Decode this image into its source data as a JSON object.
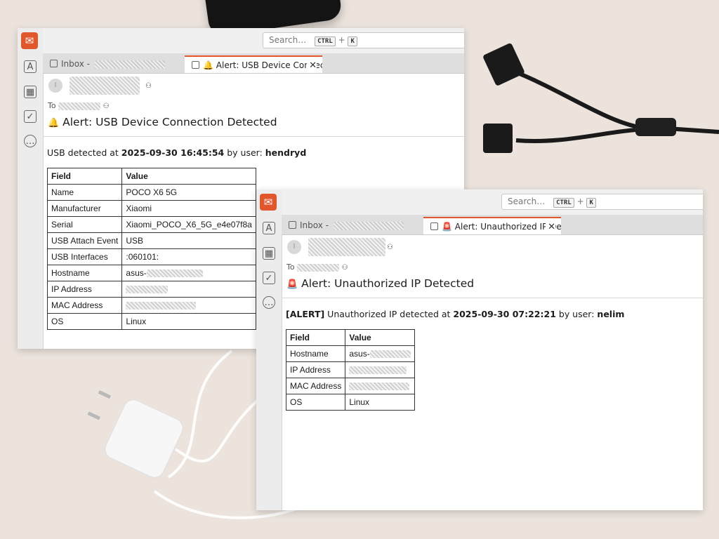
{
  "windows": [
    {
      "id": "usb",
      "search": {
        "placeholder": "Search…",
        "key1": "CTRL",
        "plus": "+",
        "key2": "K"
      },
      "tabs": {
        "inbox_label": "Inbox -",
        "active_label": "Alert: USB Device Connecti",
        "active_icon": "bell-icon"
      },
      "header": {
        "to_label": "To",
        "subject_icon": "🔔",
        "subject": "Alert: USB Device Connection Detected"
      },
      "message": {
        "prefix": "",
        "text1": "USB detected at ",
        "datetime": "2025-09-30 16:45:54",
        "text2": " by user: ",
        "user": "hendryd"
      },
      "table": {
        "headers": [
          "Field",
          "Value"
        ],
        "rows": [
          [
            "Name",
            "POCO X6 5G"
          ],
          [
            "Manufacturer",
            "Xiaomi"
          ],
          [
            "Serial",
            "Xiaomi_POCO_X6_5G_e4e07f8a"
          ],
          [
            "USB Attach Event",
            "USB"
          ],
          [
            "USB Interfaces",
            ":060101:"
          ],
          [
            "Hostname",
            "asus-"
          ],
          [
            "IP Address",
            ""
          ],
          [
            "MAC Address",
            ""
          ],
          [
            "OS",
            "Linux"
          ]
        ]
      }
    },
    {
      "id": "ip",
      "search": {
        "placeholder": "Search…",
        "key1": "CTRL",
        "plus": "+",
        "key2": "K"
      },
      "tabs": {
        "inbox_label": "Inbox -",
        "active_label": "Alert: Unauthorized IP Det",
        "active_icon": "siren-icon"
      },
      "header": {
        "to_label": "To",
        "subject_icon": "🚨",
        "subject": "Alert: Unauthorized IP Detected"
      },
      "message": {
        "prefix": "[ALERT]",
        "text1": " Unauthorized IP detected at ",
        "datetime": "2025-09-30 07:22:21",
        "text2": " by user: ",
        "user": "nelim"
      },
      "table": {
        "headers": [
          "Field",
          "Value"
        ],
        "rows": [
          [
            "Hostname",
            "asus-"
          ],
          [
            "IP Address",
            ""
          ],
          [
            "MAC Address",
            ""
          ],
          [
            "OS",
            "Linux"
          ]
        ]
      }
    }
  ],
  "colors": {
    "accent": "#e2562c",
    "background": "#ebe3dc"
  }
}
